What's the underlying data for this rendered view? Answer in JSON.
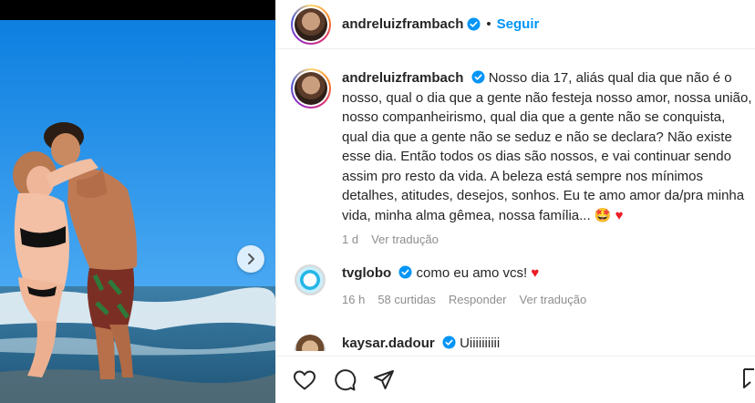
{
  "post": {
    "username": "andreluizframbach",
    "follow_label": "Seguir",
    "dot": "•"
  },
  "caption": {
    "username": "andreluizframbach",
    "text": "Nosso dia 17, aliás qual dia que não é o nosso, qual o dia que a gente não festeja nosso amor, nossa união, nosso companheirismo, qual dia que a gente não se conquista, qual dia que a gente não se seduz e não se declara? Não existe esse dia. Então todos os dias são nossos, e vai continuar sendo assim pro resto da vida. A beleza está sempre nos mínimos detalhes, atitudes, desejos, sonhos. Eu te amo amor da/pra minha vida, minha alma gêmea, nossa família... 🤩",
    "heart": "♥",
    "time": "1 d",
    "translate_label": "Ver tradução"
  },
  "comments": [
    {
      "username": "tvglobo",
      "text": "como eu amo vcs!",
      "heart": "♥",
      "time": "16 h",
      "likes": "58 curtidas",
      "reply_label": "Responder",
      "translate_label": "Ver tradução"
    },
    {
      "username": "kaysar.dadour",
      "text": "Uiiiiiiiiii"
    }
  ],
  "colors": {
    "accent": "#0095f6",
    "heart": "#ed1c24",
    "muted": "#8e8e8e"
  },
  "icons": [
    "verified-badge-icon",
    "chevron-right-icon",
    "heart-icon",
    "comment-icon",
    "share-icon",
    "bookmark-icon"
  ]
}
